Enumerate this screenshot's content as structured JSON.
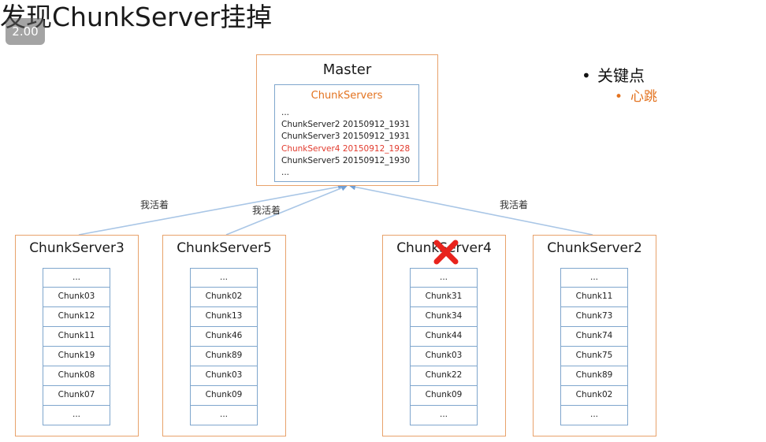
{
  "title": "发现ChunkServer挂掉",
  "speed_badge": "2.00",
  "bullets": {
    "main": "关键点",
    "sub": "心跳"
  },
  "master": {
    "title": "Master",
    "inner_title": "ChunkServers",
    "lines": [
      {
        "text": "...",
        "dead": false
      },
      {
        "text": "ChunkServer2 20150912_1931",
        "dead": false
      },
      {
        "text": "ChunkServer3 20150912_1931",
        "dead": false
      },
      {
        "text": "ChunkServer4 20150912_1928",
        "dead": true
      },
      {
        "text": "ChunkServer5 20150912_1930",
        "dead": false
      },
      {
        "text": "...",
        "dead": false
      }
    ]
  },
  "heartbeat_label": "我活着",
  "servers": [
    {
      "name": "ChunkServer3",
      "chunks": [
        "...",
        "Chunk03",
        "Chunk12",
        "Chunk11",
        "Chunk19",
        "Chunk08",
        "Chunk07",
        "..."
      ]
    },
    {
      "name": "ChunkServer5",
      "chunks": [
        "...",
        "Chunk02",
        "Chunk13",
        "Chunk46",
        "Chunk89",
        "Chunk03",
        "Chunk09",
        "..."
      ]
    },
    {
      "name": "ChunkServer4",
      "chunks": [
        "...",
        "Chunk31",
        "Chunk34",
        "Chunk44",
        "Chunk03",
        "Chunk22",
        "Chunk09",
        "..."
      ],
      "failed": true
    },
    {
      "name": "ChunkServer2",
      "chunks": [
        "...",
        "Chunk11",
        "Chunk73",
        "Chunk74",
        "Chunk75",
        "Chunk89",
        "Chunk02",
        "..."
      ]
    }
  ],
  "colors": {
    "box_border": "#e8a26b",
    "inner_border": "#7fa6cd",
    "accent_orange": "#e37320",
    "dead_red": "#e23b2e",
    "link_blue": "#a9c6e6"
  }
}
